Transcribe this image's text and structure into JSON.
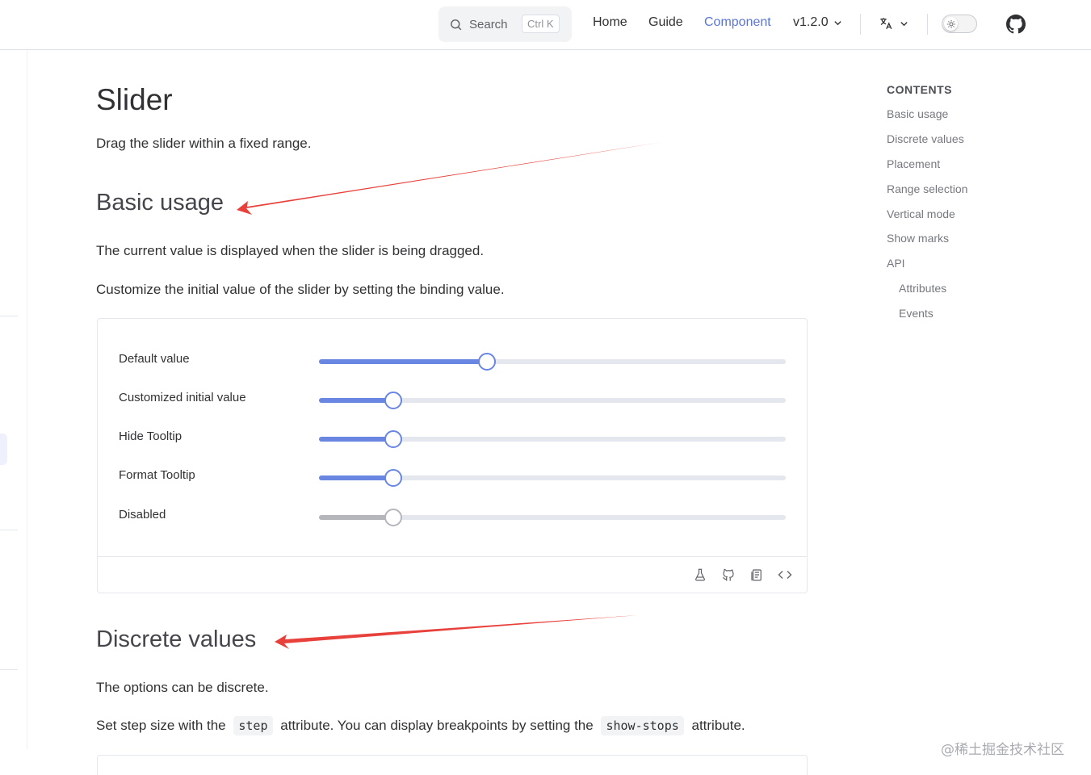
{
  "navbar": {
    "search_placeholder": "Search",
    "search_shortcut": "Ctrl K",
    "links": [
      "Home",
      "Guide",
      "Component"
    ],
    "active_link": "Component",
    "version": "v1.2.0",
    "icons": [
      "search-icon",
      "translate-icon",
      "sun-icon",
      "github-icon",
      "chevron-down-icon"
    ],
    "accent_color": "#5a75d6"
  },
  "page": {
    "title": "Slider",
    "lead": "Drag the slider within a fixed range."
  },
  "basic": {
    "heading": "Basic usage",
    "desc1": "The current value is displayed when the slider is being dragged.",
    "desc2": "Customize the initial value of the slider by setting the binding value.",
    "rows": [
      {
        "label": "Default value",
        "value": 36,
        "disabled": false
      },
      {
        "label": "Customized initial value",
        "value": 16,
        "disabled": false
      },
      {
        "label": "Hide Tooltip",
        "value": 16,
        "disabled": false
      },
      {
        "label": "Format Tooltip",
        "value": 16,
        "disabled": false
      },
      {
        "label": "Disabled",
        "value": 16,
        "disabled": true
      }
    ],
    "tools": [
      "playground-icon",
      "github-icon",
      "copy-icon",
      "code-icon"
    ]
  },
  "discrete": {
    "heading": "Discrete values",
    "desc1": "The options can be discrete.",
    "desc2_a": "Set step size with the",
    "code1": "step",
    "desc2_b": "attribute. You can display breakpoints by setting the",
    "code2": "show-stops",
    "desc2_c": "attribute."
  },
  "toc": {
    "title": "CONTENTS",
    "items": [
      "Basic usage",
      "Discrete values",
      "Placement",
      "Range selection",
      "Vertical mode",
      "Show marks",
      "API"
    ],
    "subitems": [
      "Attributes",
      "Events"
    ]
  },
  "watermark": "@稀土掘金技术社区",
  "annotation_color": "#e8413c"
}
